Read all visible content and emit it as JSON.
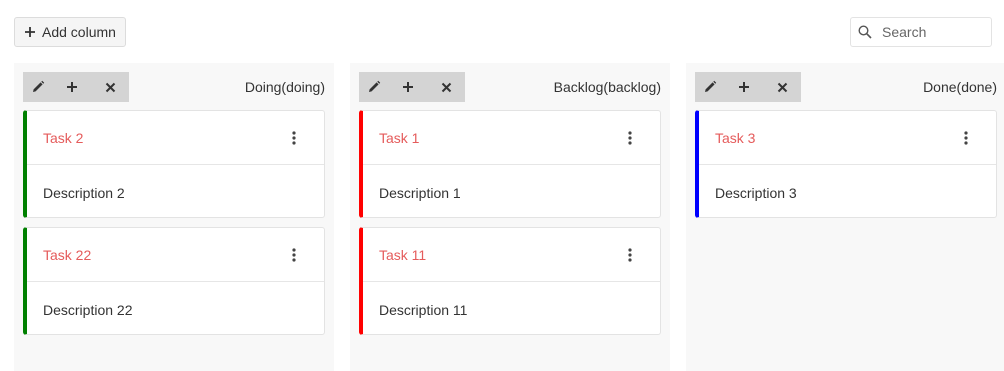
{
  "toolbar": {
    "add_column_label": "Add column",
    "plus_icon": "plus-icon"
  },
  "search": {
    "placeholder": "Search",
    "value": "",
    "icon": "search-icon"
  },
  "columns": [
    {
      "title": "Doing(doing)",
      "tools": [
        "pencil-icon",
        "plus-icon",
        "close-icon"
      ],
      "cards": [
        {
          "title": "Task 2",
          "description": "Description 2",
          "color": "#008000"
        },
        {
          "title": "Task 22",
          "description": "Description 22",
          "color": "#008000"
        }
      ]
    },
    {
      "title": "Backlog(backlog)",
      "tools": [
        "pencil-icon",
        "plus-icon",
        "close-icon"
      ],
      "cards": [
        {
          "title": "Task 1",
          "description": "Description 1",
          "color": "#ff0000"
        },
        {
          "title": "Task 11",
          "description": "Description 11",
          "color": "#ff0000"
        }
      ]
    },
    {
      "title": "Done(done)",
      "tools": [
        "pencil-icon",
        "plus-icon",
        "close-icon"
      ],
      "cards": [
        {
          "title": "Task 3",
          "description": "Description 3",
          "color": "#0000ff"
        }
      ]
    }
  ],
  "colors": {
    "task_title": "#e55b5b",
    "column_bg": "#f8f8f8",
    "toolbar_bg": "#d4d4d4"
  }
}
